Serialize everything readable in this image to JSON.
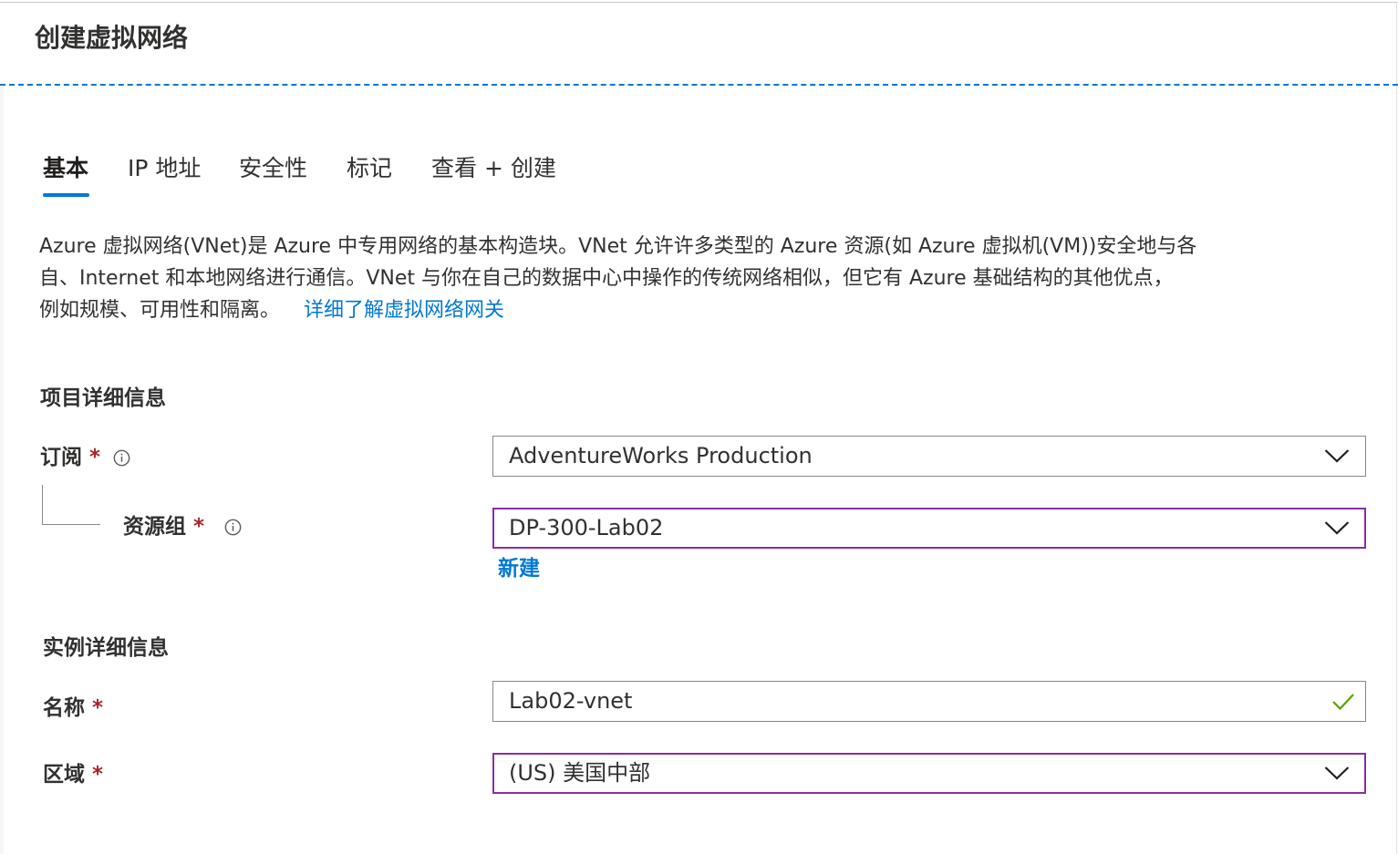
{
  "header": {
    "title": "创建虚拟网络"
  },
  "tabs": [
    {
      "label": "基本",
      "active": true
    },
    {
      "label": "IP 地址",
      "active": false
    },
    {
      "label": "安全性",
      "active": false
    },
    {
      "label": "标记",
      "active": false
    },
    {
      "label": "查看 + 创建",
      "active": false
    }
  ],
  "description": {
    "line1": "Azure 虚拟网络(VNet)是 Azure 中专用网络的基本构造块。VNet 允许许多类型的 Azure 资源(如 Azure 虚拟机(VM))安全地与各",
    "line2": "自、Internet 和本地网络进行通信。VNet 与你在自己的数据中心中操作的传统网络相似，但它有 Azure 基础结构的其他优点，",
    "line3": "例如规模、可用性和隔离。",
    "link": "详细了解虚拟网络网关"
  },
  "project_details": {
    "heading": "项目详细信息",
    "subscription": {
      "label": "订阅",
      "required": "*",
      "value": "AdventureWorks Production"
    },
    "resource_group": {
      "label": "资源组",
      "required": "*",
      "value": "DP-300-Lab02",
      "new_link": "新建"
    }
  },
  "instance_details": {
    "heading": "实例详细信息",
    "name": {
      "label": "名称",
      "required": "*",
      "value": "Lab02-vnet",
      "valid": true
    },
    "region": {
      "label": "区域",
      "required": "*",
      "value": "(US) 美国中部"
    }
  },
  "icons": {
    "info": "info-circle-icon",
    "dropdown": "chevron-down-icon",
    "valid": "checkmark-icon"
  },
  "colors": {
    "accent": "#0078d4",
    "focus_border": "#8a2da5",
    "required": "#a4262c",
    "valid": "#57a300"
  }
}
